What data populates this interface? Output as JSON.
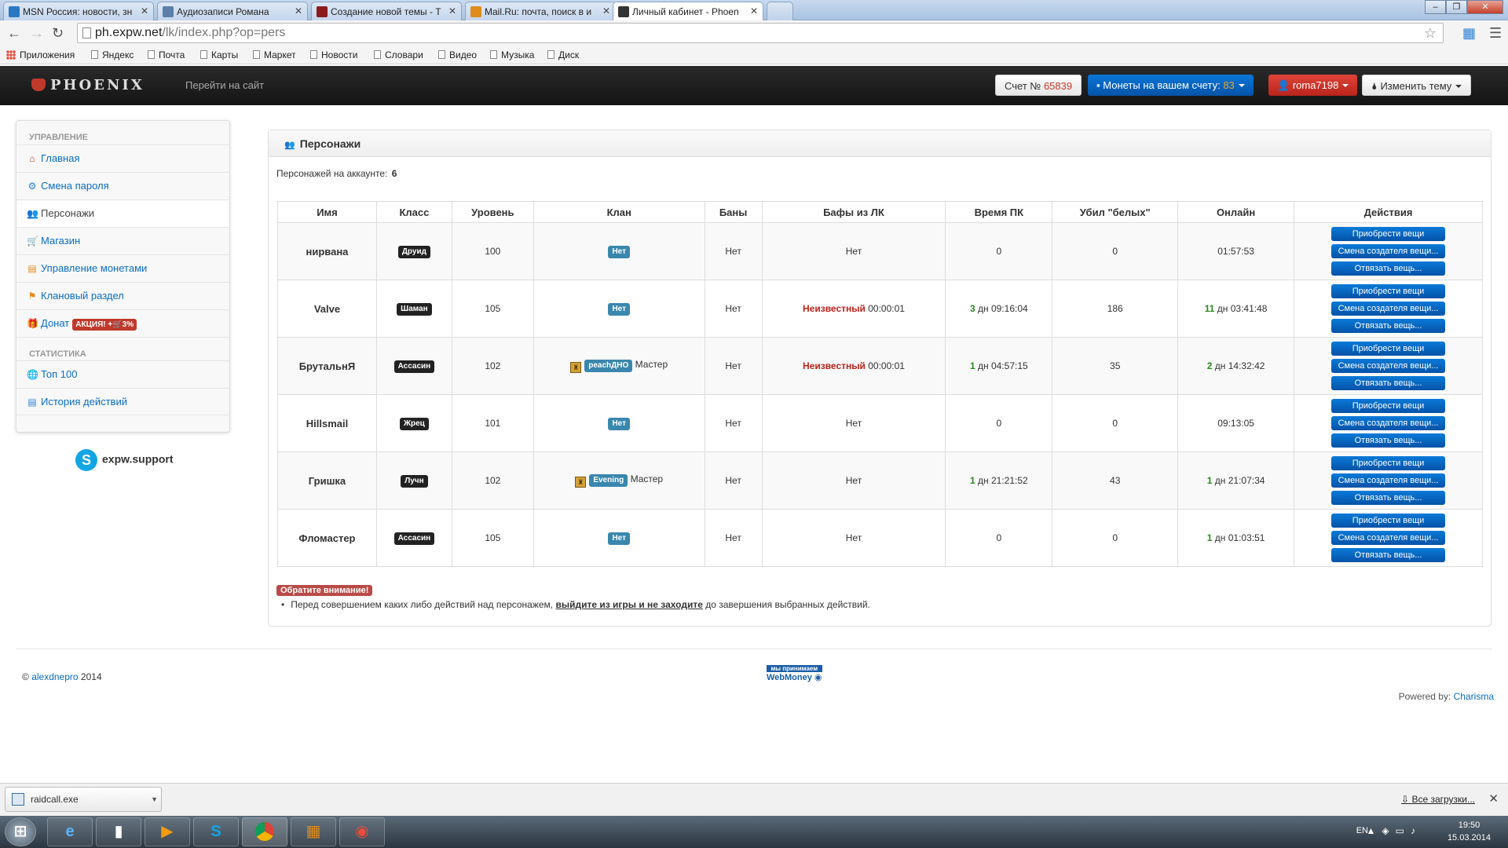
{
  "browser": {
    "tabs": [
      {
        "title": "MSN Россия: новости, зн",
        "color": "#2b79c2"
      },
      {
        "title": "Аудиозаписи Романа",
        "color": "#5b7fa8"
      },
      {
        "title": "Создание новой темы - Т",
        "color": "#8a1c1c"
      },
      {
        "title": "Mail.Ru: почта, поиск в и",
        "color": "#e08b1a"
      },
      {
        "title": "Личный кабинет - Phoen",
        "color": "#333333"
      }
    ],
    "url_host": "ph.expw.net",
    "url_path": "/lk/index.php?op=pers",
    "bookmarks": [
      "Приложения",
      "Яндекс",
      "Почта",
      "Карты",
      "Маркет",
      "Новости",
      "Словари",
      "Видео",
      "Музыка",
      "Диск"
    ]
  },
  "navbar": {
    "logo": "PHOENIX",
    "goto_site": "Перейти на сайт",
    "account_label": "Счет №",
    "account_number": "65839",
    "coins_label": "Монеты на вашем счету:",
    "coins_value": "83",
    "user": "roma7198",
    "theme": "Изменить тему"
  },
  "sidebar": {
    "section1": "Управление",
    "items1": [
      {
        "label": "Главная",
        "icon": "home-icon",
        "color": "#c0392b"
      },
      {
        "label": "Смена пароля",
        "icon": "gear-icon",
        "color": "#2a7fd4"
      },
      {
        "label": "Персонажи",
        "icon": "people-icon",
        "color": "#e9a23b"
      },
      {
        "label": "Магазин",
        "icon": "cart-icon",
        "color": "#3a9a2a"
      },
      {
        "label": "Управление монетами",
        "icon": "coins-icon",
        "color": "#e08b1a"
      },
      {
        "label": "Клановый раздел",
        "icon": "flag-icon",
        "color": "#e08b1a"
      },
      {
        "label": "Донат",
        "icon": "gift-icon",
        "color": "#c0392b"
      }
    ],
    "promo": "АКЦИЯ! +🛒3%",
    "section2": "Статистика",
    "items2": [
      {
        "label": "Топ 100",
        "icon": "globe-icon",
        "color": "#2a7fd4"
      },
      {
        "label": "История действий",
        "icon": "document-icon",
        "color": "#2a7fd4"
      }
    ],
    "support": "expw.support"
  },
  "panel": {
    "title": "Персонажи",
    "count_label": "Персонажей на аккаунте:",
    "count_value": "6",
    "columns": [
      "Имя",
      "Класс",
      "Уровень",
      "Клан",
      "Баны",
      "Бафы из ЛК",
      "Время ПК",
      "Убил \"белых\"",
      "Онлайн",
      "Действия"
    ],
    "rows": [
      {
        "name": "нирвана",
        "class": "Друид",
        "level": "100",
        "clan": {
          "type": "none",
          "label": "Нет"
        },
        "bans": "Нет",
        "buffs": {
          "type": "none",
          "text": "Нет"
        },
        "pk": {
          "days": "",
          "time": "0"
        },
        "kills": "0",
        "online": {
          "days": "",
          "time": "01:57:53"
        }
      },
      {
        "name": "Valve",
        "class": "Шаман",
        "level": "105",
        "clan": {
          "type": "none",
          "label": "Нет"
        },
        "bans": "Нет",
        "buffs": {
          "type": "unknown",
          "label": "Неизвестный",
          "time": "00:00:01"
        },
        "pk": {
          "days": "3",
          "time": "дн 09:16:04"
        },
        "kills": "186",
        "online": {
          "days": "11",
          "time": "дн 03:41:48"
        }
      },
      {
        "name": "БрутальнЯ",
        "class": "Ассасин",
        "level": "102",
        "clan": {
          "type": "clan",
          "label": "peachДНО",
          "role": "Мастер"
        },
        "bans": "Нет",
        "buffs": {
          "type": "unknown",
          "label": "Неизвестный",
          "time": "00:00:01"
        },
        "pk": {
          "days": "1",
          "time": "дн 04:57:15"
        },
        "kills": "35",
        "online": {
          "days": "2",
          "time": "дн 14:32:42"
        }
      },
      {
        "name": "Hillsmail",
        "class": "Жрец",
        "level": "101",
        "clan": {
          "type": "none",
          "label": "Нет"
        },
        "bans": "Нет",
        "buffs": {
          "type": "none",
          "text": "Нет"
        },
        "pk": {
          "days": "",
          "time": "0"
        },
        "kills": "0",
        "online": {
          "days": "",
          "time": "09:13:05"
        }
      },
      {
        "name": "Гришка",
        "class": "Лучн",
        "level": "102",
        "clan": {
          "type": "clan",
          "label": "Evening",
          "role": "Мастер"
        },
        "bans": "Нет",
        "buffs": {
          "type": "none",
          "text": "Нет"
        },
        "pk": {
          "days": "1",
          "time": "дн 21:21:52"
        },
        "kills": "43",
        "online": {
          "days": "1",
          "time": "дн 21:07:34"
        }
      },
      {
        "name": "Фломастер",
        "class": "Ассасин",
        "level": "105",
        "clan": {
          "type": "none",
          "label": "Нет"
        },
        "bans": "Нет",
        "buffs": {
          "type": "none",
          "text": "Нет"
        },
        "pk": {
          "days": "",
          "time": "0"
        },
        "kills": "0",
        "online": {
          "days": "1",
          "time": "дн 01:03:51"
        }
      }
    ],
    "actions": [
      "Приобрести вещи",
      "Смена создателя вещи...",
      "Отвязать вещь..."
    ],
    "notice_label": "Обратите внимание!",
    "notice_before": "Перед совершением каких либо действий над персонажем,",
    "notice_bold": "выйдите из игры и не заходите",
    "notice_after": "до завершения выбранных действий."
  },
  "footer": {
    "copy_symbol": "©",
    "author": "alexdnepro",
    "year": "2014",
    "webmoney_top": "мы принимаем",
    "webmoney": "WebMoney",
    "powered_label": "Powered by:",
    "powered_link": "Charisma"
  },
  "downloads": {
    "file": "raidcall.exe",
    "all": "Все загрузки..."
  },
  "taskbar": {
    "lang": "EN",
    "time": "19:50",
    "date": "15.03.2014"
  }
}
